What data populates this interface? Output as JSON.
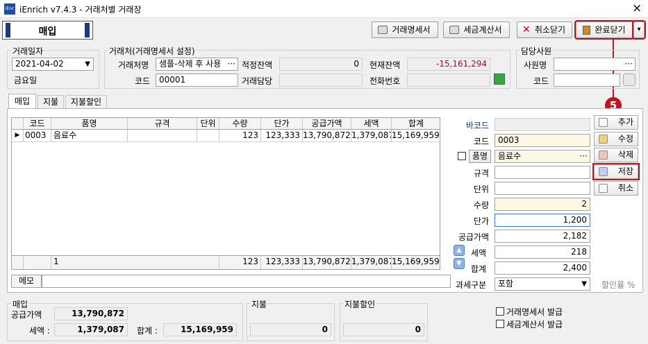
{
  "window": {
    "title": "iEnrich v7.4.3 - 거래처별 거래장",
    "logo": "iEnc",
    "close_glyph": "×"
  },
  "mode_label": "매입",
  "toolbar": {
    "invoice_label": "거래명세서",
    "tax_invoice_label": "세금계산서",
    "cancel_close_label": "취소닫기",
    "complete_close_label": "완료닫기",
    "dropdown_glyph": "▾",
    "step_badge": "5"
  },
  "header": {
    "date_group": "거래일자",
    "date_value": "2021-04-02",
    "weekday": "금요일",
    "customer_group": "거래처(거래명세서 설정)",
    "customer_label": "거래처명",
    "customer_value": "샘플-삭제 후 사용",
    "customer_more": "···",
    "code_label": "코드",
    "code_value": "00001",
    "proper_balance_label": "적정잔액",
    "proper_balance_value": "0",
    "current_balance_label": "현재잔액",
    "current_balance_value": "-15,161,294",
    "contact_label": "거래담당",
    "contact_value": "",
    "phone_label": "전화번호",
    "phone_value": "",
    "staff_group": "담당사원",
    "staff_name_label": "사원명",
    "staff_name_value": "",
    "staff_more": "···",
    "staff_code_label": "코드",
    "staff_code_value": ""
  },
  "tabs": [
    {
      "label": "매입"
    },
    {
      "label": "지불"
    },
    {
      "label": "지불할인"
    }
  ],
  "grid": {
    "columns": [
      "코드",
      "품명",
      "규격",
      "단위",
      "수량",
      "단가",
      "공급가액",
      "세액",
      "합계"
    ],
    "rows": [
      {
        "marker": "▶",
        "code": "0003",
        "name": "음료수",
        "spec": "",
        "unit": "",
        "qty": "123",
        "price": "123,333",
        "supply": "13,790,872",
        "tax": "1,379,087",
        "total": "15,169,959"
      }
    ],
    "footer": {
      "count": "1",
      "qty": "123",
      "price": "123,333",
      "supply": "13,790,872",
      "tax": "1,379,087",
      "total": "15,169,959"
    }
  },
  "memo_label": "메모",
  "memo_value": "",
  "detail": {
    "barcode_label": "바코드",
    "barcode_value": "",
    "code_label": "코드",
    "code_value": "0003",
    "name_label": "품명",
    "name_value": "음료수",
    "name_more": "···",
    "spec_label": "규격",
    "spec_value": "",
    "unit_label": "단위",
    "unit_value": "",
    "qty_label": "수량",
    "qty_value": "2",
    "price_label": "단가",
    "price_value": "1,200",
    "supply_label": "공급가액",
    "supply_value": "2,182",
    "tax_label": "세액",
    "tax_value": "218",
    "total_label": "합계",
    "total_value": "2,400",
    "taxtype_label": "과세구분",
    "taxtype_value": "포함",
    "discount_label": "할인률 %"
  },
  "side_buttons": {
    "add": "추가",
    "edit": "수정",
    "delete": "삭제",
    "save": "저장",
    "cancel": "취소"
  },
  "summary": {
    "purchase_group": "매입",
    "supply_label": "공급가액",
    "supply_value": "13,790,872",
    "tax_label": "세액 :",
    "tax_value": "1,379,087",
    "total_label": "합계 :",
    "total_value": "15,169,959",
    "payment_group": "지불",
    "payment_value": "0",
    "discount_group": "지불할인",
    "discount_value": "0",
    "issue_invoice": "거래명세서 발급",
    "issue_tax_invoice": "세금계산서 발급"
  }
}
